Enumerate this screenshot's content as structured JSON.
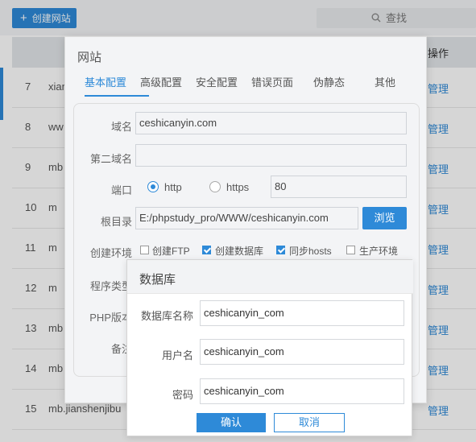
{
  "toolbar": {
    "create_label": "创建网站",
    "search_label": "查找"
  },
  "table": {
    "op_header": "操作",
    "rows": [
      {
        "num": "7",
        "name": "xian",
        "action": "管理"
      },
      {
        "num": "8",
        "name": "ww",
        "action": "管理"
      },
      {
        "num": "9",
        "name": "mb",
        "action": "管理"
      },
      {
        "num": "10",
        "name": "m",
        "action": "管理"
      },
      {
        "num": "11",
        "name": "m",
        "action": "管理"
      },
      {
        "num": "12",
        "name": "m",
        "action": "管理"
      },
      {
        "num": "13",
        "name": "mb",
        "action": "管理"
      },
      {
        "num": "14",
        "name": "mb",
        "action": "管理"
      },
      {
        "num": "15",
        "name": "mb.jianshenjibu",
        "action": "管理"
      }
    ]
  },
  "site_dialog": {
    "title": "网站",
    "tabs": [
      "基本配置",
      "高级配置",
      "安全配置",
      "错误页面",
      "伪静态",
      "其他"
    ],
    "labels": {
      "domain": "域名",
      "second_domain": "第二域名",
      "port": "端口",
      "root": "根目录",
      "env": "创建环境",
      "program_type": "程序类型",
      "php_version": "PHP版本",
      "note": "备注"
    },
    "domain_value": "ceshicanyin.com",
    "second_domain_value": "",
    "port_options": [
      "http",
      "https"
    ],
    "port_selected": "http",
    "port_value": "80",
    "root_value": "E:/phpstudy_pro/WWW/ceshicanyin.com",
    "browse_label": "浏览",
    "env_options": [
      {
        "label": "创建FTP",
        "checked": false
      },
      {
        "label": "创建数据库",
        "checked": true
      },
      {
        "label": "同步hosts",
        "checked": true
      },
      {
        "label": "生产环境",
        "checked": false
      }
    ]
  },
  "db_dialog": {
    "title": "数据库",
    "labels": {
      "db_name": "数据库名称",
      "username": "用户名",
      "password": "密码"
    },
    "db_name_value": "ceshicanyin_com",
    "username_value": "ceshicanyin_com",
    "password_value": "ceshicanyin_com",
    "ok_label": "确认",
    "cancel_label": "取消"
  },
  "colors": {
    "accent": "#2e8ad8"
  }
}
